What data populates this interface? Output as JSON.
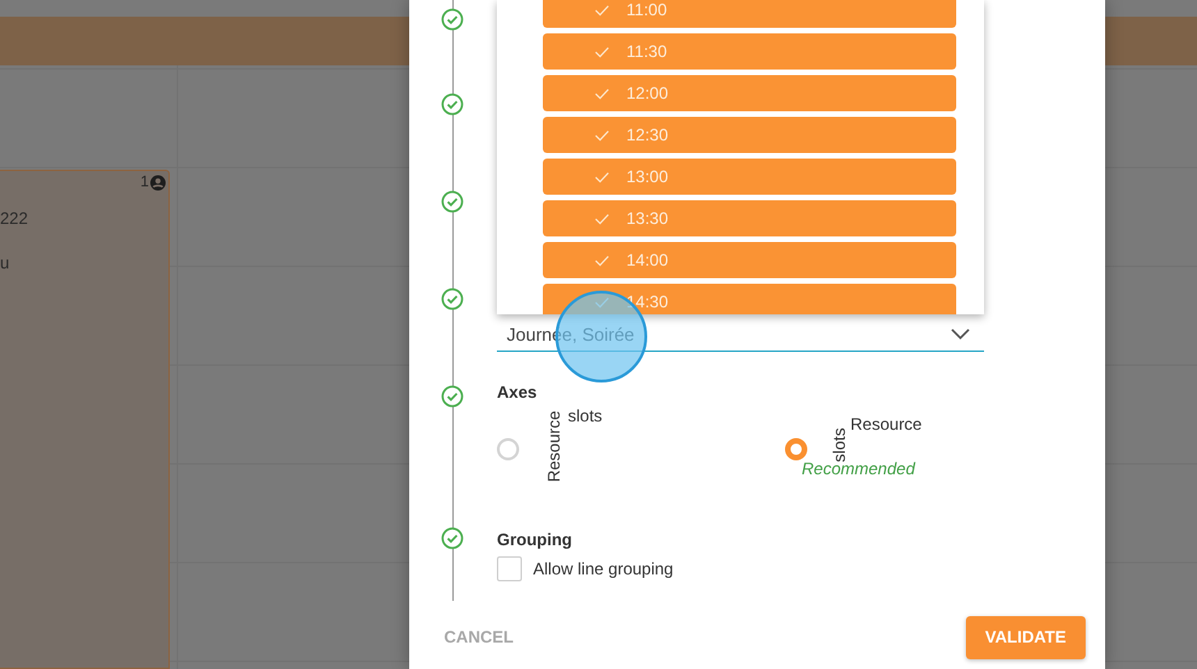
{
  "background": {
    "event": {
      "count": "1",
      "line_1": "222",
      "line_2": "u"
    }
  },
  "steps": [
    {
      "completed": true
    },
    {
      "completed": true
    },
    {
      "completed": true
    },
    {
      "completed": true
    },
    {
      "completed": true
    },
    {
      "completed": true
    }
  ],
  "time_menu": {
    "items": [
      {
        "label": "11:00",
        "checked": true
      },
      {
        "label": "11:30",
        "checked": true
      },
      {
        "label": "12:00",
        "checked": true
      },
      {
        "label": "12:30",
        "checked": true
      },
      {
        "label": "13:00",
        "checked": true
      },
      {
        "label": "13:30",
        "checked": true
      },
      {
        "label": "14:00",
        "checked": true
      },
      {
        "label": "14:30",
        "checked": true
      }
    ]
  },
  "period_select": {
    "value": "Journée, Soirée"
  },
  "axes": {
    "title": "Axes",
    "options": [
      {
        "vertical": "Resource",
        "horizontal": "slots",
        "selected": false
      },
      {
        "vertical": "slots",
        "horizontal": "Resource",
        "note": "Recommended",
        "selected": true
      }
    ]
  },
  "grouping": {
    "title": "Grouping",
    "checkbox": {
      "label": "Allow line grouping",
      "checked": false
    }
  },
  "buttons": {
    "cancel": "CANCEL",
    "validate": "VALIDATE"
  }
}
